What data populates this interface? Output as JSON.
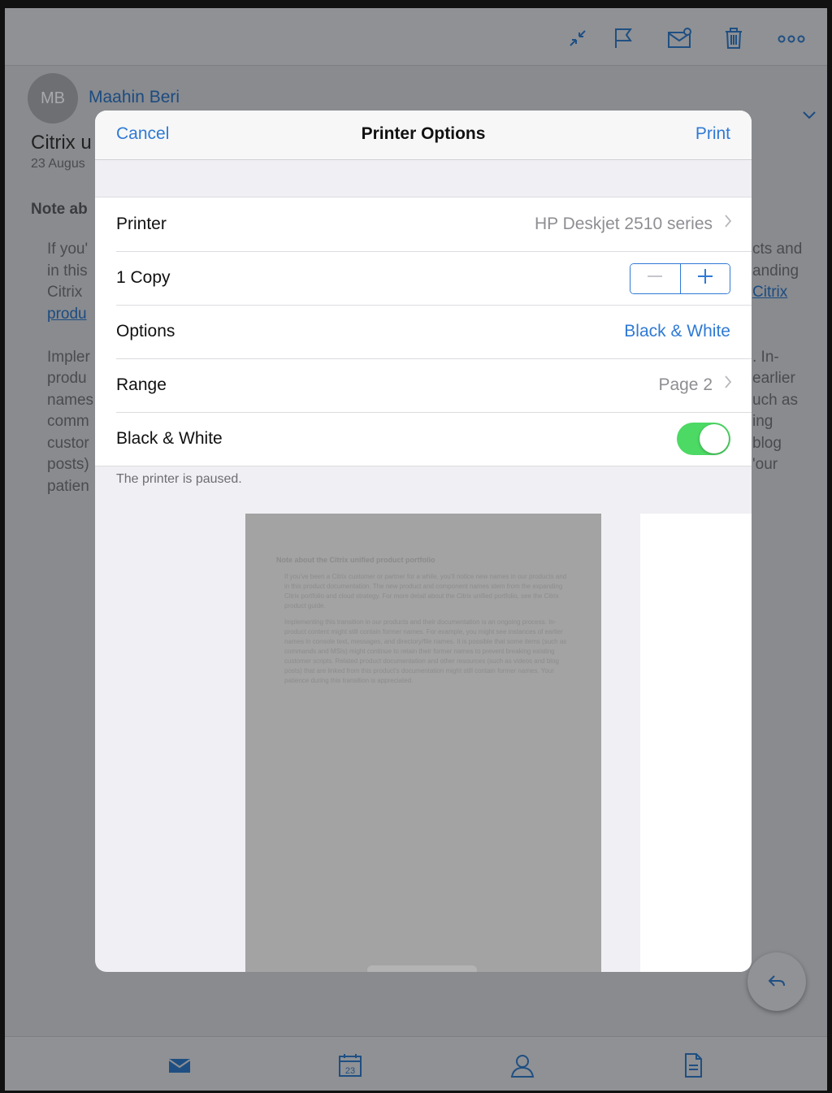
{
  "email": {
    "avatar_initials": "MB",
    "sender": "Maahin Beri",
    "subject": "Citrix u",
    "date": "23 Augus",
    "note_heading": "Note ab",
    "left_lines": [
      "If you'",
      "in this",
      "Citrix ",
      "produ",
      "",
      "Impler",
      "produ",
      "names",
      "comm",
      "custor",
      "posts)",
      "patien"
    ],
    "left_link_line_index": 3,
    "right_lines": [
      "cts and",
      "anding",
      "Citrix",
      "",
      "",
      ". In-",
      "earlier",
      "uch as",
      "ing",
      "blog",
      "'our"
    ],
    "right_link_line_index": 2
  },
  "toolbar": {
    "icons": [
      "collapse-icon",
      "flag-icon",
      "mark-mail-icon",
      "trash-icon",
      "more-icon"
    ]
  },
  "dialog": {
    "cancel": "Cancel",
    "title": "Printer Options",
    "print": "Print",
    "rows": {
      "printer_label": "Printer",
      "printer_value": "HP Deskjet 2510 series",
      "copies_label": "1 Copy",
      "options_label": "Options",
      "options_value": "Black & White",
      "range_label": "Range",
      "range_value": "Page 2",
      "bw_label": "Black & White",
      "bw_on": true
    },
    "footer_note": "The printer is paused.",
    "preview": {
      "heading": "Note about the Citrix unified product portfolio",
      "para1": "If you've been a Citrix customer or partner for a while, you'll notice new names in our products and in this product documentation. The new product and component names stem from the expanding Citrix portfolio and cloud strategy. For more detail about the Citrix unified portfolio, see the Citrix product guide.",
      "para2": "Implementing this transition in our products and their documentation is an ongoing process. In-product content might still contain former names. For example, you might see instances of earlier names in console text, messages, and directory/file names. It is possible that some items (such as commands and MSIs) might continue to retain their former names to prevent breaking existing customer scripts. Related product documentation and other resources (such as videos and blog posts) that are linked from this product's documentation might still contain former names. Your patience during this transition is appreciated."
    }
  },
  "tabbar": {
    "items": [
      "mail-icon",
      "calendar-icon",
      "contacts-icon",
      "files-icon"
    ],
    "calendar_day": "23"
  },
  "colors": {
    "accent": "#2f7ad4",
    "toggle_on": "#4cd964"
  }
}
